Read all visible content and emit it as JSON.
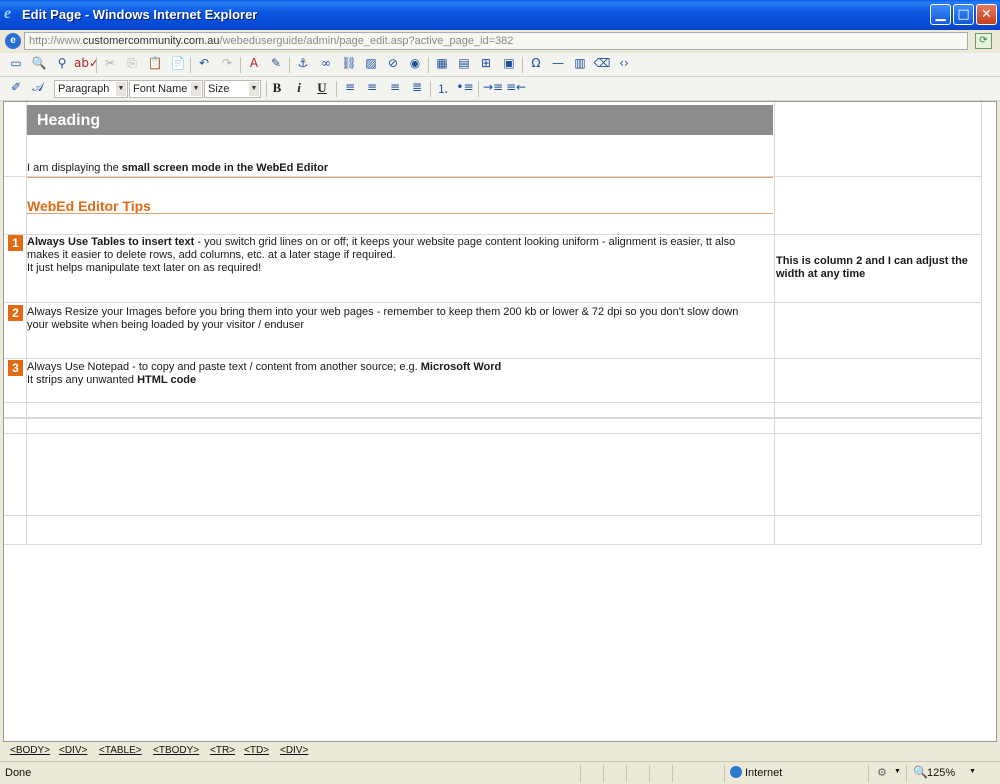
{
  "window": {
    "title": "Edit Page - Windows Internet Explorer",
    "minimize": "▁",
    "maximize": "□",
    "close": "✕"
  },
  "address": {
    "prefix": "http://www.",
    "domain": "customercommunity.com.au",
    "path": "/webeduserguide/admin/page_edit.asp?active_page_id=382"
  },
  "toolbar2": {
    "format_select": "Paragraph",
    "font_select": "Font Name",
    "size_select": "Size",
    "bold": "B",
    "italic": "i",
    "underline": "U"
  },
  "document": {
    "heading": "Heading",
    "intro_prefix": "I am displaying the ",
    "intro_bold": "small screen mode in the WebEd Editor",
    "tips_title": "WebEd Editor Tips",
    "tips": [
      {
        "number": "1",
        "lead": "Always Use Tables to insert text",
        "line1": " - you switch grid lines on or off; it keeps your website page content looking uniform - alignment is easier, tt also",
        "line2": "makes it easier to delete rows, add columns, etc. at a later stage if required.",
        "line3": "It just helps manipulate text later on as required!"
      },
      {
        "number": "2",
        "line1": "Always Resize your Images before you bring them into your web pages - remember to keep them 200 kb or lower & 72 dpi so you don't slow down",
        "line2": "your website when being loaded by your visitor / enduser"
      },
      {
        "number": "3",
        "line1_prefix": "Always Use Notepad - to copy and paste text / content from another source; e.g. ",
        "line1_bold": "Microsoft Word",
        "line2_prefix": "It strips any unwanted ",
        "line2_bold": "HTML code"
      }
    ],
    "column2_line1": "This is column 2 and I can adjust the",
    "column2_line2": "width at any time"
  },
  "dom_path": [
    "<BODY>",
    "<DIV>",
    "<TABLE>",
    "<TBODY>",
    "<TR>",
    "<TD>",
    "<DIV>"
  ],
  "status": {
    "text": "Done",
    "zone": "Internet",
    "zoom": "125%"
  },
  "colors": {
    "accent_orange": "#e06b14",
    "heading_gray": "#8c8c8c",
    "titlebar_blue": "#0b58e2"
  }
}
